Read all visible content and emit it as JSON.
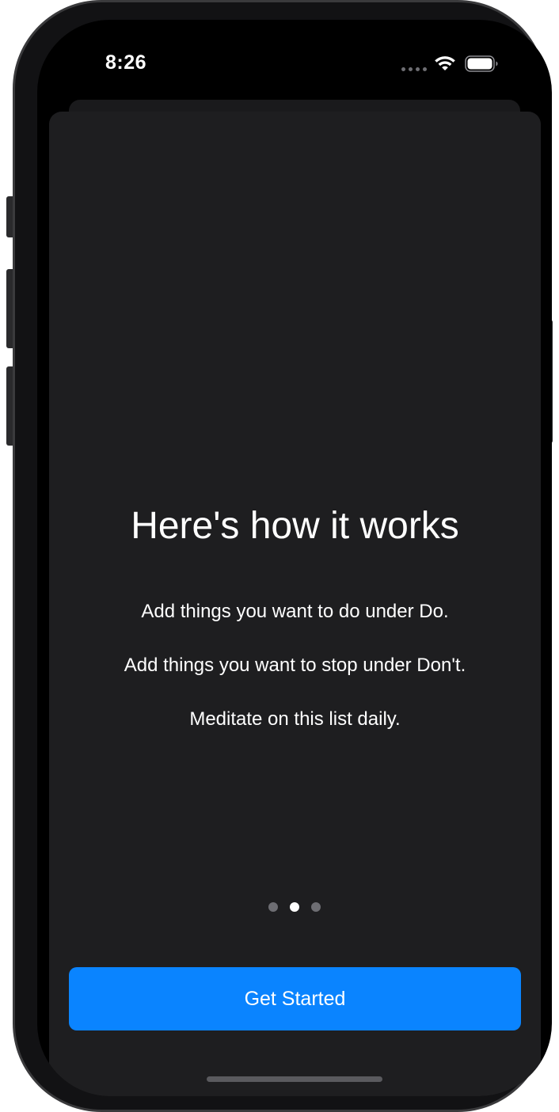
{
  "status_bar": {
    "time": "8:26",
    "wifi_icon": "wifi-icon",
    "battery_icon": "battery-icon",
    "cellular_icon": "signal-dots-icon"
  },
  "onboarding": {
    "title": "Here's how it works",
    "lines": [
      "Add things you want to do under Do.",
      "Add things you want to stop under Don't.",
      "Meditate on this list daily."
    ],
    "page_indicator": {
      "total": 3,
      "current": 2
    },
    "cta_label": "Get Started"
  },
  "colors": {
    "accent": "#0a84ff",
    "sheet_background": "#1e1e20",
    "screen_background": "#000000",
    "text": "#ffffff",
    "inactive_dot": "#6e6e73"
  }
}
